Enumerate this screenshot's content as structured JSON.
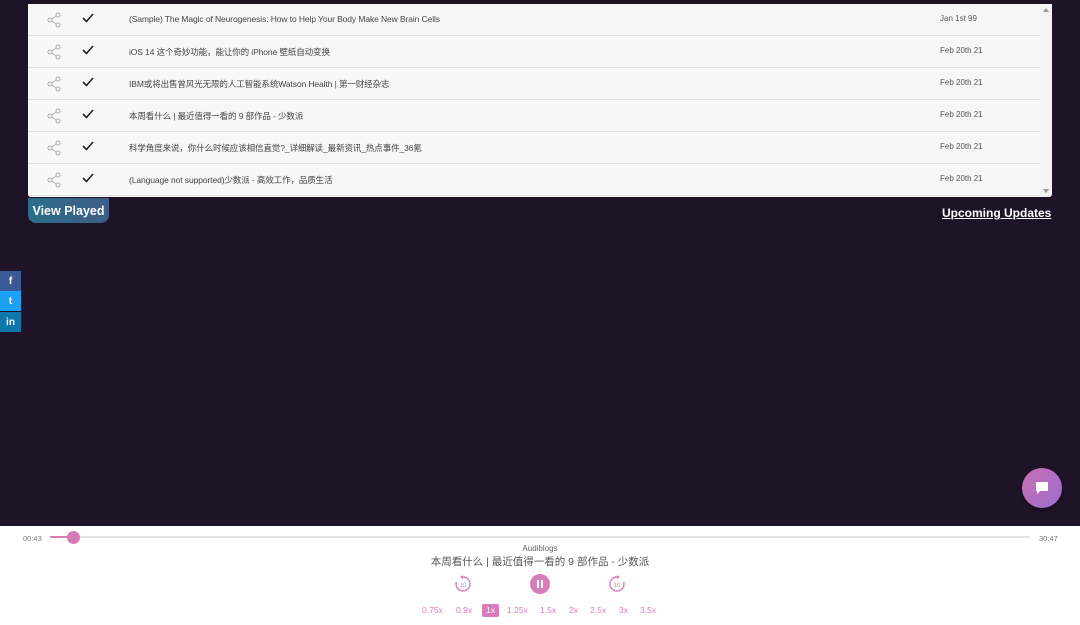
{
  "episodes": [
    {
      "title": "(Sample) The Magic of Neurogenesis: How to Help Your Body Make New Brain Cells",
      "date": "Jan 1st 99"
    },
    {
      "title": "iOS 14 这个奇妙功能，能让你的 iPhone 壁纸自动变换",
      "date": "Feb 20th 21"
    },
    {
      "title": "IBM或将出售曾风光无限的人工智能系统Watson Health | 第一财经杂志",
      "date": "Feb 20th 21"
    },
    {
      "title": "本周看什么 | 最近值得一看的 9 部作品 - 少数派",
      "date": "Feb 20th 21"
    },
    {
      "title": "科学角度来说，你什么时候应该相信直觉?_详细解读_最新资讯_热点事件_36氪",
      "date": "Feb 20th 21"
    },
    {
      "title": "(Language not supported)少数派 - 高效工作，品质生活",
      "date": "Feb 20th 21"
    }
  ],
  "buttons": {
    "view_played": "View Played",
    "upcoming_updates": "Upcoming Updates"
  },
  "social": {
    "facebook": "f",
    "twitter": "t",
    "linkedin": "in"
  },
  "player": {
    "current_time": "00:43",
    "total_time": "30:47",
    "progress": 0.023,
    "podcast": "Audiblogs",
    "title": "本周看什么 | 最近值得一看的 9 部作品 - 少数派",
    "rewind_seconds": "10",
    "forward_seconds": "10",
    "speeds": [
      "0.75x",
      "0.9x",
      "1x",
      "1.25x",
      "1.5x",
      "2x",
      "2.5x",
      "3x",
      "3.5x"
    ],
    "active_speed": "1x"
  },
  "colors": {
    "background": "#1f1328",
    "accent": "#d87cb8",
    "view_played": "#2a6e8a"
  }
}
